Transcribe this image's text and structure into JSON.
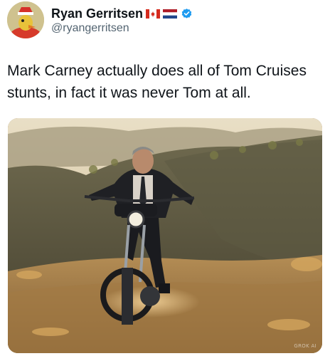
{
  "author": {
    "display_name": "Ryan Gerritsen",
    "handle": "@ryangerritsen",
    "flags": [
      "canada-flag-icon",
      "netherlands-flag-icon"
    ],
    "verified_badge": "verified-badge-icon"
  },
  "tweet": {
    "text": "Mark Carney actually does all of Tom Cruises stunts, in fact it was never Tom at all."
  },
  "media": {
    "description_icon": "photo",
    "watermark": "GROK AI"
  },
  "colors": {
    "handle": "#536471",
    "verified": "#1d9bf0",
    "text": "#0f1419"
  }
}
